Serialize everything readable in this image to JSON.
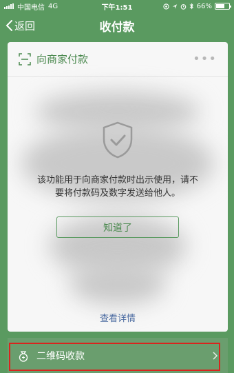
{
  "status_bar": {
    "carrier": "中国电信",
    "network": "4G",
    "time": "下午1:51",
    "battery_text": "66%",
    "battery_level": 0.66
  },
  "nav": {
    "back_label": "返回",
    "title": "收付款"
  },
  "card": {
    "title": "向商家付款",
    "more_label": "•••",
    "notice_line1": "该功能用于向商家付款时出示使用，请不",
    "notice_line2": "要将付款码及数字发送给他人。",
    "ack_button": "知道了",
    "details_link": "查看详情"
  },
  "bottom": {
    "qr_label": "二维码收款"
  },
  "colors": {
    "primary_green": "#5a9a60",
    "highlight_red": "#d9241d",
    "link_blue": "#4a6aa0"
  }
}
